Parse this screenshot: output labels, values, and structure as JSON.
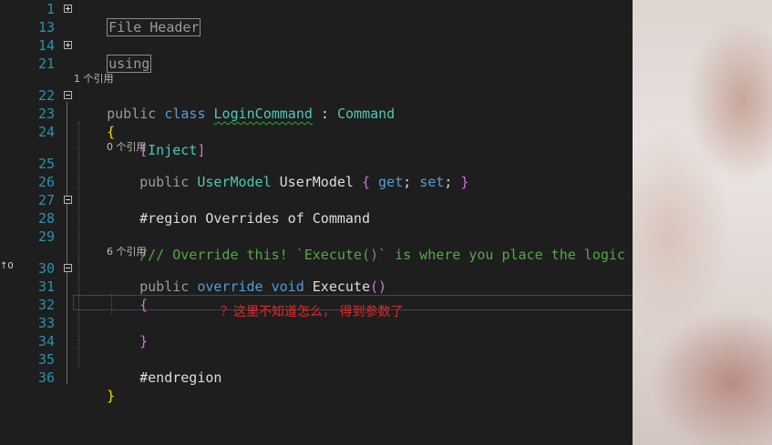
{
  "lines": [
    {
      "num": "1",
      "html": "<span class=\"box\" data-name=\"collapsed-region-label\" data-bind=\"regions.file_header\" data-interactable=\"true\"></span>"
    },
    {
      "num": "13"
    },
    {
      "num": "14"
    },
    {
      "num": "21"
    },
    {
      "num": "22"
    },
    {
      "num": "23"
    },
    {
      "num": "24"
    },
    {
      "num": "25"
    },
    {
      "num": "26"
    },
    {
      "num": "27"
    },
    {
      "num": "28"
    },
    {
      "num": "29"
    },
    {
      "num": "30"
    },
    {
      "num": "31"
    },
    {
      "num": "32"
    },
    {
      "num": "33"
    },
    {
      "num": "34"
    },
    {
      "num": "35"
    },
    {
      "num": "36"
    }
  ],
  "regions": {
    "file_header": "File Header",
    "using": "using"
  },
  "code_lens": {
    "class_refs": "1 个引用",
    "property_refs": "0 个引用",
    "method_refs": "6 个引用"
  },
  "code": {
    "l22_public": "public",
    "l22_class": "class",
    "l22_name": "LoginCommand",
    "l22_colon": " : ",
    "l22_base": "Command",
    "l23_brace": "{",
    "l24_open": "[",
    "l24_attr": "Inject",
    "l24_close": "]",
    "l25_public": "public",
    "l25_type": "UserModel",
    "l25_name": "UserModel",
    "l25_ob": "{",
    "l25_get": "get",
    "l25_semi1": ";",
    "l25_set": "set",
    "l25_semi2": ";",
    "l25_cb": "}",
    "l27": "#region Overrides of Command",
    "l29": "/// Override this! `Execute()` is where you place the logic for your Command.",
    "l30_public": "public",
    "l30_override": "override",
    "l30_void": "void",
    "l30_name": "Execute",
    "l30_parens": "()",
    "l31": "{",
    "l33": "}",
    "l35": "#endregion",
    "l36": "}"
  },
  "annotation": "？这里不知道怎么， 得到参数了",
  "margin_indicator": "↑0"
}
